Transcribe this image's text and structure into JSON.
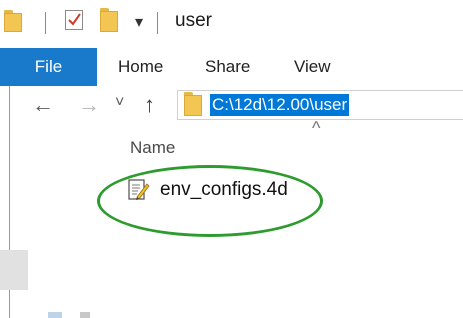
{
  "window": {
    "title": "user"
  },
  "quick_access": {
    "icons": [
      "folder-icon",
      "properties-checkbox-icon",
      "new-folder-icon",
      "customize-dropdown-icon"
    ]
  },
  "ribbon": {
    "tabs": [
      {
        "label": "File",
        "active": true
      },
      {
        "label": "Home"
      },
      {
        "label": "Share"
      },
      {
        "label": "View"
      }
    ]
  },
  "nav": {
    "back": "←",
    "forward": "→",
    "recent": "˅",
    "up": "↑"
  },
  "address": {
    "path": "C:\\12d\\12.00\\user"
  },
  "file_list": {
    "sort_indicator": "^",
    "column_name": "Name",
    "items": [
      {
        "name": "env_configs.4d",
        "icon": "text-file-edit-icon"
      }
    ]
  },
  "colors": {
    "accent": "#1979ca",
    "selection": "#0078d7",
    "highlight": "#2e9b2e",
    "folder": "#f3c654"
  }
}
